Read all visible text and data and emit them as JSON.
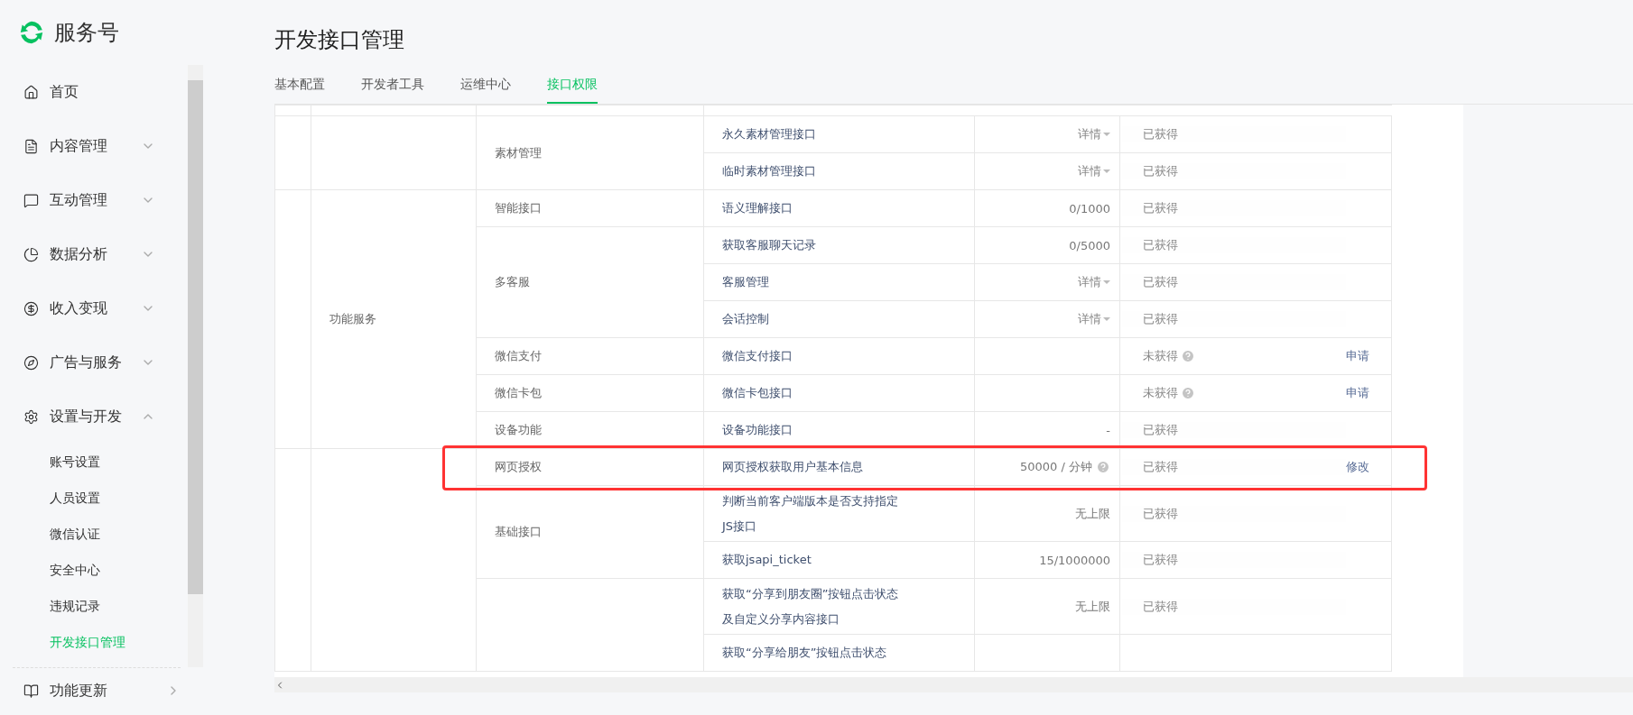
{
  "brand": {
    "name": "服务号"
  },
  "sidebar": {
    "items": [
      {
        "label": "首页"
      },
      {
        "label": "内容管理",
        "expanded": false
      },
      {
        "label": "互动管理",
        "expanded": false
      },
      {
        "label": "数据分析",
        "expanded": false
      },
      {
        "label": "收入变现",
        "expanded": false
      },
      {
        "label": "广告与服务",
        "expanded": false
      },
      {
        "label": "设置与开发",
        "expanded": true,
        "children": [
          {
            "label": "账号设置",
            "selected": false
          },
          {
            "label": "人员设置",
            "selected": false
          },
          {
            "label": "微信认证",
            "selected": false
          },
          {
            "label": "安全中心",
            "selected": false
          },
          {
            "label": "违规记录",
            "selected": false
          },
          {
            "label": "开发接口管理",
            "selected": true
          }
        ]
      }
    ],
    "footer_item": {
      "label": "功能更新"
    }
  },
  "page": {
    "title": "开发接口管理",
    "tabs": [
      {
        "label": "基本配置",
        "selected": false
      },
      {
        "label": "开发者工具",
        "selected": false
      },
      {
        "label": "运维中心",
        "selected": false
      },
      {
        "label": "接口权限",
        "selected": true
      }
    ]
  },
  "table": {
    "groups": [
      {
        "categories": [
          {
            "name": "素材管理",
            "apis": [
              {
                "name": "永久素材管理接口",
                "kind": "detail",
                "quota": "详情",
                "status": "已获得",
                "status_help": false
              },
              {
                "name": "临时素材管理接口",
                "kind": "detail",
                "quota": "详情",
                "status": "已获得",
                "status_help": false
              }
            ]
          }
        ]
      },
      {
        "name": "功能服务",
        "categories": [
          {
            "name": "智能接口",
            "apis": [
              {
                "name": "语义理解接口",
                "kind": "text",
                "quota": "0/1000",
                "status": "已获得",
                "status_help": false
              }
            ]
          },
          {
            "name": "多客服",
            "apis": [
              {
                "name": "获取客服聊天记录",
                "kind": "text",
                "quota": "0/5000",
                "status": "已获得",
                "status_help": false
              },
              {
                "name": "客服管理",
                "kind": "detail",
                "quota": "详情",
                "status": "已获得",
                "status_help": false
              },
              {
                "name": "会话控制",
                "kind": "detail",
                "quota": "详情",
                "status": "已获得",
                "status_help": false
              }
            ]
          },
          {
            "name": "微信支付",
            "apis": [
              {
                "name": "微信支付接口",
                "kind": "none",
                "status": "未获得",
                "status_help": true,
                "action": "申请"
              }
            ]
          },
          {
            "name": "微信卡包",
            "apis": [
              {
                "name": "微信卡包接口",
                "kind": "none",
                "status": "未获得",
                "status_help": true,
                "action": "申请"
              }
            ]
          },
          {
            "name": "设备功能",
            "apis": [
              {
                "name": "设备功能接口",
                "kind": "text",
                "quota": "-",
                "status": "已获得",
                "status_help": false
              }
            ]
          }
        ]
      },
      {
        "categories": [
          {
            "name": "网页授权",
            "highlighted": true,
            "apis": [
              {
                "name": "网页授权获取用户基本信息",
                "kind": "help",
                "quota": "50000 / 分钟",
                "status": "已获得",
                "status_help": false,
                "action": "修改"
              }
            ]
          },
          {
            "name": "基础接口",
            "highlighted": false,
            "apis": [
              {
                "name": "判断当前客户端版本是否支持指定JS接口",
                "kind": "text",
                "quota": "无上限",
                "status": "已获得",
                "status_help": false
              },
              {
                "name": "获取jsapi_ticket",
                "kind": "text",
                "quota": "15/1000000",
                "status": "已获得",
                "status_help": false
              }
            ]
          },
          {
            "highlighted": false,
            "apis": [
              {
                "name": "获取“分享到朋友圈”按钮点击状态及自定义分享内容接口",
                "kind": "text",
                "quota": "无上限",
                "status": "已获得",
                "status_help": false
              },
              {
                "name": "获取“分享给朋友”按钮点击状态",
                "kind": "none"
              }
            ]
          }
        ]
      }
    ]
  }
}
